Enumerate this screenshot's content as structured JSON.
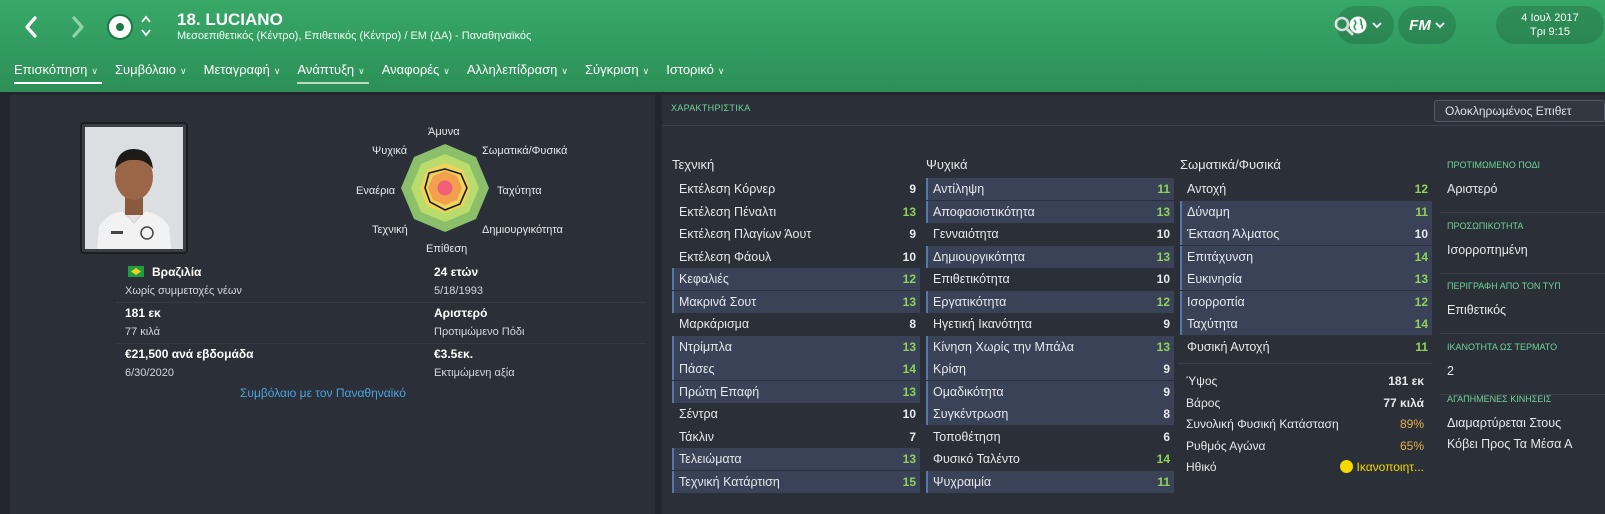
{
  "header": {
    "player_title": "18. LUCIANO",
    "subtitle": "Μεσοεπιθετικός (Κέντρο), Επιθετικός (Κέντρο) / ΕΜ (ΔΑ) - Παναθηναϊκός",
    "fm_label": "FM",
    "date": "4 Ιουλ 2017",
    "time": "Τρι 9:15"
  },
  "tabs": [
    {
      "label": "Επισκόπηση"
    },
    {
      "label": "Συμβόλαιο"
    },
    {
      "label": "Μεταγραφή"
    },
    {
      "label": "Ανάπτυξη"
    },
    {
      "label": "Αναφορές"
    },
    {
      "label": "Αλληλεπίδραση"
    },
    {
      "label": "Σύγκριση"
    },
    {
      "label": "Ιστορικό"
    }
  ],
  "radar": {
    "labels": {
      "top": "Άμυνα",
      "phys": "Σωματικά/Φυσικά",
      "speed": "Ταχύτητα",
      "creat": "Δημιουργικότητα",
      "attack": "Επίθεση",
      "tech": "Τεχνική",
      "aerial": "Εναέρια",
      "mental": "Ψυχικά"
    }
  },
  "profile": {
    "nationality": "Βραζιλία",
    "caps": "Χωρίς συμμετοχές νέων",
    "age": "24 ετών",
    "dob": "5/18/1993",
    "height": "181 εκ",
    "weight": "77 κιλά",
    "foot": "Αριστερό",
    "foot_label": "Προτιμώμενο Πόδι",
    "wage": "€21,500 ανά εβδομάδα",
    "contract_end": "6/30/2020",
    "value": "€3.5εκ.",
    "value_label": "Εκτιμώμενη αξία",
    "contract_link": "Συμβόλαιο με τον Παναθηναϊκό"
  },
  "attributes": {
    "section_title": "ΧΑΡΑΚΤΗΡΙΣΤΙΚΑ",
    "view_button": "Ολοκληρωμένος Επιθετ",
    "technical": {
      "title": "Τεχνική",
      "rows": [
        {
          "name": "Εκτέλεση Κόρνερ",
          "value": "9",
          "hl": false
        },
        {
          "name": "Εκτέλεση Πέναλτι",
          "value": "13",
          "hl": false
        },
        {
          "name": "Εκτέλεση Πλαγίων Άουτ",
          "value": "9",
          "hl": false
        },
        {
          "name": "Εκτέλεση Φάουλ",
          "value": "10",
          "hl": false
        },
        {
          "name": "Κεφαλιές",
          "value": "12",
          "hl": true
        },
        {
          "name": "Μακρινά Σουτ",
          "value": "13",
          "hl": true
        },
        {
          "name": "Μαρκάρισμα",
          "value": "8",
          "hl": false
        },
        {
          "name": "Ντρίμπλα",
          "value": "13",
          "hl": true
        },
        {
          "name": "Πάσες",
          "value": "14",
          "hl": true
        },
        {
          "name": "Πρώτη Επαφή",
          "value": "13",
          "hl": true
        },
        {
          "name": "Σέντρα",
          "value": "10",
          "hl": false
        },
        {
          "name": "Τάκλιν",
          "value": "7",
          "hl": false
        },
        {
          "name": "Τελειώματα",
          "value": "13",
          "hl": true
        },
        {
          "name": "Τεχνική Κατάρτιση",
          "value": "15",
          "hl": true
        }
      ]
    },
    "mental": {
      "title": "Ψυχικά",
      "rows": [
        {
          "name": "Αντίληψη",
          "value": "11",
          "hl": true
        },
        {
          "name": "Αποφασιστικότητα",
          "value": "13",
          "hl": true
        },
        {
          "name": "Γενναιότητα",
          "value": "10",
          "hl": false
        },
        {
          "name": "Δημιουργικότητα",
          "value": "13",
          "hl": true
        },
        {
          "name": "Επιθετικότητα",
          "value": "10",
          "hl": false
        },
        {
          "name": "Εργατικότητα",
          "value": "12",
          "hl": true
        },
        {
          "name": "Ηγετική Ικανότητα",
          "value": "9",
          "hl": false
        },
        {
          "name": "Κίνηση Χωρίς την Μπάλα",
          "value": "13",
          "hl": true
        },
        {
          "name": "Κρίση",
          "value": "9",
          "hl": true
        },
        {
          "name": "Ομαδικότητα",
          "value": "9",
          "hl": true
        },
        {
          "name": "Συγκέντρωση",
          "value": "8",
          "hl": true
        },
        {
          "name": "Τοποθέτηση",
          "value": "6",
          "hl": false
        },
        {
          "name": "Φυσικό Ταλέντο",
          "value": "14",
          "hl": false
        },
        {
          "name": "Ψυχραιμία",
          "value": "11",
          "hl": true
        }
      ]
    },
    "physical": {
      "title": "Σωματικά/Φυσικά",
      "rows": [
        {
          "name": "Αντοχή",
          "value": "12",
          "hl": false
        },
        {
          "name": "Δύναμη",
          "value": "11",
          "hl": true
        },
        {
          "name": "Έκταση Άλματος",
          "value": "10",
          "hl": true
        },
        {
          "name": "Επιτάχυνση",
          "value": "14",
          "hl": true
        },
        {
          "name": "Ευκινησία",
          "value": "13",
          "hl": true
        },
        {
          "name": "Ισορροπία",
          "value": "12",
          "hl": true
        },
        {
          "name": "Ταχύτητα",
          "value": "14",
          "hl": true
        },
        {
          "name": "Φυσική Αντοχή",
          "value": "11",
          "hl": false
        }
      ]
    },
    "body": [
      {
        "label": "Ύψος",
        "value": "181 εκ"
      },
      {
        "label": "Βάρος",
        "value": "77 κιλά"
      },
      {
        "label": "Συνολική Φυσική Κατάσταση",
        "value": "89%"
      },
      {
        "label": "Ρυθμός Αγώνα",
        "value": "65%"
      },
      {
        "label": "Ηθικό",
        "value": "Ικανοποιητ..."
      }
    ]
  },
  "side": [
    {
      "label": "ΠΡΟΤΙΜΩΜΕΝΟ ΠΟΔΙ",
      "values": [
        "Αριστερό"
      ]
    },
    {
      "label": "ΠΡΟΣΩΠΙΚΟΤΗΤΑ",
      "values": [
        "Ισορροπημένη"
      ]
    },
    {
      "label": "ΠΕΡΙΓΡΑΦΗ ΑΠΟ ΤΟΝ ΤΥΠ",
      "values": [
        "Επιθετικός"
      ]
    },
    {
      "label": "ΙΚΑΝΟΤΗΤΑ ΩΣ ΤΕΡΜΑΤΟ",
      "values": [
        "2"
      ]
    },
    {
      "label": "ΑΓΑΠΗΜΕΝΕΣ ΚΙΝΗΣΕΙΣ",
      "values": [
        "Διαμαρτύρεται Στους",
        "Κόβει Προς Τα Μέσα Α"
      ]
    }
  ],
  "colors": {
    "accent": "#6fd597",
    "header": "#35a464",
    "good": "#8fd35a",
    "warn": "#e8b04a",
    "morale": "#f5d800"
  }
}
